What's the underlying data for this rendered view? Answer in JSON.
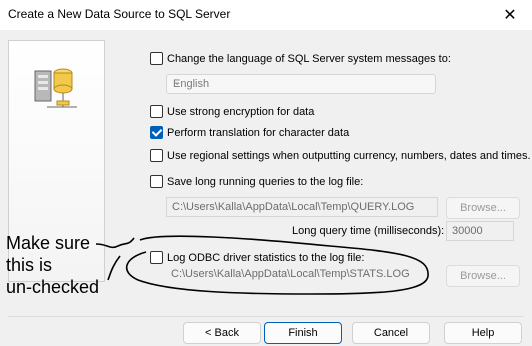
{
  "window": {
    "title": "Create a New Data Source to SQL Server"
  },
  "options": {
    "change_language": "Change the language of SQL Server system messages to:",
    "language_value": "English",
    "strong_encryption": "Use strong encryption for data",
    "translation": "Perform translation for character data",
    "regional": "Use regional settings when outputting currency, numbers, dates and times.",
    "save_long": "Save long running queries to the log file:",
    "query_log_path": "C:\\Users\\Kalla\\AppData\\Local\\Temp\\QUERY.LOG",
    "browse": "Browse...",
    "long_query_label": "Long query time (milliseconds):",
    "long_query_value": "30000",
    "log_odbc": "Log ODBC driver statistics to the log file:",
    "stats_log_path": "C:\\Users\\Kalla\\AppData\\Local\\Temp\\STATS.LOG"
  },
  "buttons": {
    "back": "< Back",
    "finish": "Finish",
    "cancel": "Cancel",
    "help": "Help"
  },
  "annotation": {
    "line1": "Make sure",
    "line2": "this is",
    "line3": "un-checked"
  },
  "colors": {
    "accent": "#005fb8"
  },
  "icons": {
    "close": "close-icon",
    "server": "server-database-icon"
  }
}
